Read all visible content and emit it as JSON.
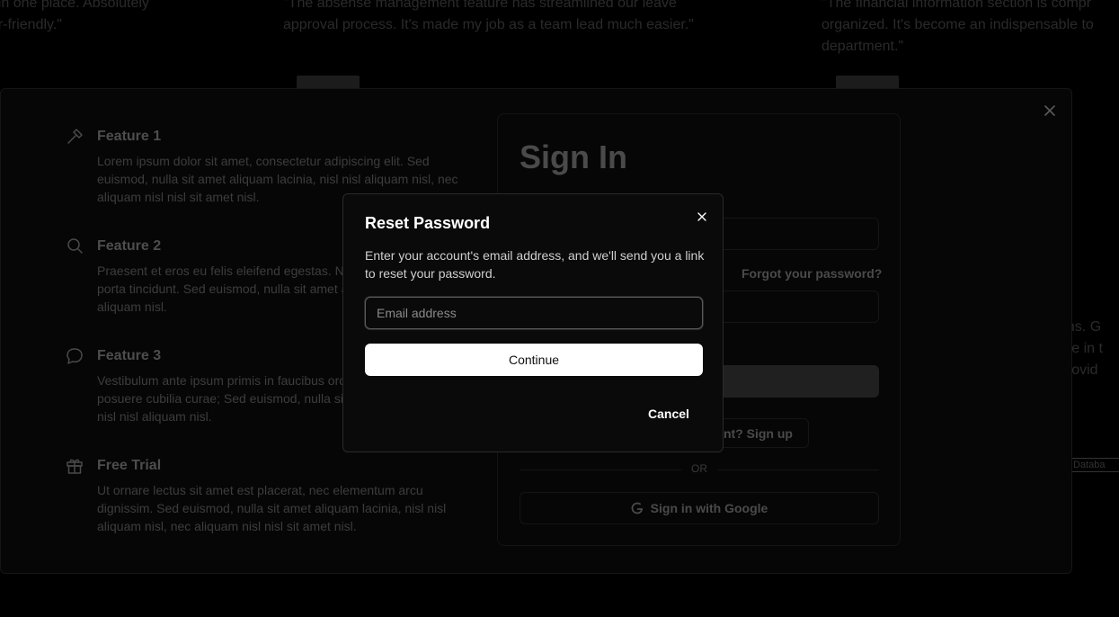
{
  "background": {
    "testimonials": [
      "te in one place. Absolutely\nper-friendly.\"",
      "\"The absense management feature has streamlined our leave\napproval process. It's made my job as a team lead much easier.\"",
      "\"The financial information section is compr\norganized. It's become an indispensable to\ndepartment.\""
    ],
    "side_text": "ons. G\nore in t\nprovid",
    "side_db": "Databa"
  },
  "features": [
    {
      "icon": "hammer-icon",
      "title": "Feature 1",
      "description": "Lorem ipsum dolor sit amet, consectetur adipiscing elit. Sed euismod, nulla sit amet aliquam lacinia, nisl nisl aliquam nisl, nec aliquam nisl nisl sit amet nisl."
    },
    {
      "icon": "search-icon",
      "title": "Feature 2",
      "description": "Praesent et eros eu felis eleifend egestas. Nulla facilisi. Cras ante porta tincidunt. Sed euismod, nulla sit amet aliquam lacinia, nisl nisl aliquam nisl."
    },
    {
      "icon": "chat-icon",
      "title": "Feature 3",
      "description": "Vestibulum ante ipsum primis in faucibus orci luctus et ultrices posuere cubilia curae; Sed euismod, nulla sit amet aliquam lacinia, nisl nisl aliquam nisl."
    },
    {
      "icon": "gift-icon",
      "title": "Free Trial",
      "description": "Ut ornare lectus sit amet est placerat, nec elementum arcu dignissim. Sed euismod, nulla sit amet aliquam lacinia, nisl nisl aliquam nisl, nec aliquam nisl nisl sit amet nisl."
    }
  ],
  "signin": {
    "title": "Sign In",
    "forgot": "Forgot your password?",
    "signup": "nt? Sign up",
    "or": "OR",
    "google": "Sign in with Google"
  },
  "modal": {
    "title": "Reset Password",
    "description": "Enter your account's email address, and we'll send you a link to reset your password.",
    "email_placeholder": "Email address",
    "email_value": "",
    "continue_label": "Continue",
    "cancel_label": "Cancel"
  },
  "colors": {
    "accent": "#ffffff",
    "background": "#000000"
  }
}
